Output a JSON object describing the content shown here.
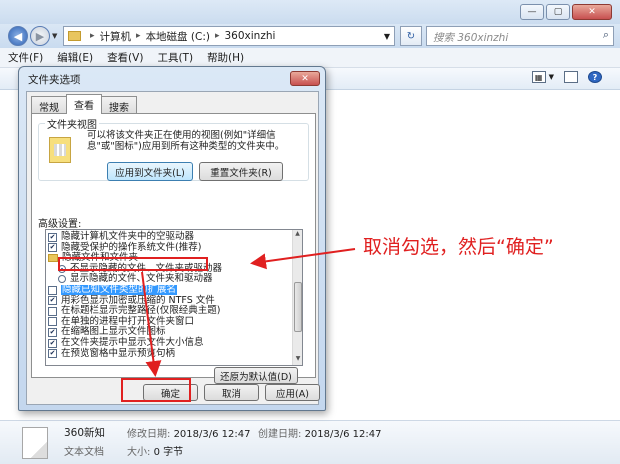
{
  "address": {
    "crumbs": [
      "计算机",
      "本地磁盘 (C:)",
      "360xinzhi"
    ],
    "search_placeholder": "搜索 360xinzhi"
  },
  "menu": [
    "文件(F)",
    "编辑(E)",
    "查看(V)",
    "工具(T)",
    "帮助(H)"
  ],
  "details": {
    "name": "360新知",
    "type": "文本文档",
    "modified_label": "修改日期:",
    "modified": "2018/3/6 12:47",
    "size_label": "大小:",
    "size": "0 字节",
    "created_label": "创建日期:",
    "created": "2018/3/6 12:47"
  },
  "dialog": {
    "title": "文件夹选项",
    "tabs": [
      "常规",
      "查看",
      "搜索"
    ],
    "folder_views_label": "文件夹视图",
    "folder_views_desc": "可以将该文件夹正在使用的视图(例如\"详细信息\"或\"图标\")应用到所有这种类型的文件夹中。",
    "apply_to_folders": "应用到文件夹(L)",
    "reset_folders": "重置文件夹(R)",
    "advanced_label": "高级设置:",
    "settings": [
      {
        "kind": "checkbox",
        "checked": true,
        "label": "隐藏计算机文件夹中的空驱动器"
      },
      {
        "kind": "checkbox",
        "checked": true,
        "label": "隐藏受保护的操作系统文件(推荐)"
      },
      {
        "kind": "folder",
        "label": "隐藏文件和文件夹"
      },
      {
        "kind": "radio",
        "checked": true,
        "label": "不显示隐藏的文件、文件夹或驱动器"
      },
      {
        "kind": "radio",
        "checked": false,
        "label": "显示隐藏的文件、文件夹和驱动器"
      },
      {
        "kind": "checkbox",
        "checked": false,
        "selected": true,
        "label": "隐藏已知文件类型的扩展名"
      },
      {
        "kind": "checkbox",
        "checked": true,
        "label": "用彩色显示加密或压缩的 NTFS 文件"
      },
      {
        "kind": "checkbox",
        "checked": false,
        "label": "在标题栏显示完整路径(仅限经典主题)"
      },
      {
        "kind": "checkbox",
        "checked": false,
        "label": "在单独的进程中打开文件夹窗口"
      },
      {
        "kind": "checkbox",
        "checked": true,
        "label": "在缩略图上显示文件图标"
      },
      {
        "kind": "checkbox",
        "checked": true,
        "label": "在文件夹提示中显示文件大小信息"
      },
      {
        "kind": "checkbox",
        "checked": true,
        "label": "在预览窗格中显示预览句柄"
      }
    ],
    "restore_defaults": "还原为默认值(D)",
    "ok": "确定",
    "cancel": "取消",
    "apply": "应用(A)"
  },
  "annotation": {
    "callout": "取消勾选，然后“确定”",
    "color": "#e02020"
  }
}
